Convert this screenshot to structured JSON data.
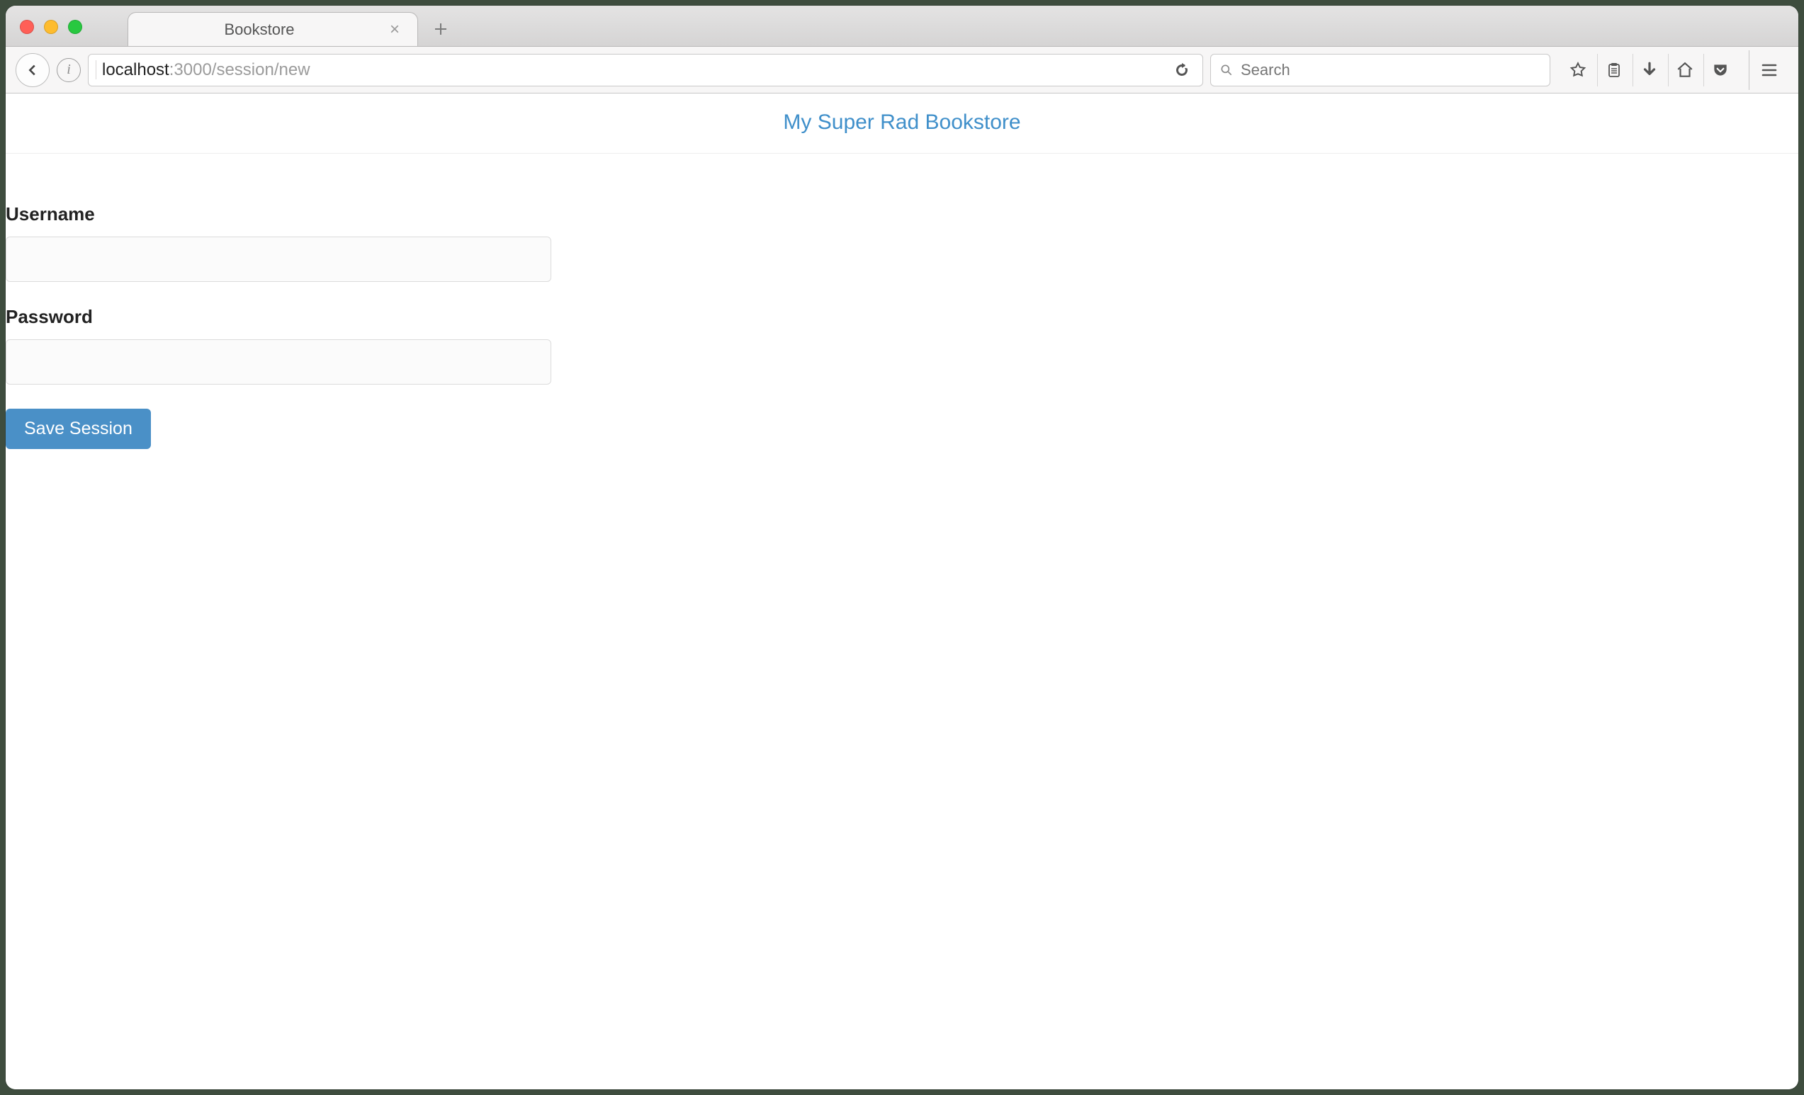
{
  "browser": {
    "tab_title": "Bookstore",
    "url_host": "localhost",
    "url_rest": ":3000/session/new",
    "search_placeholder": "Search"
  },
  "page": {
    "brand": "My Super Rad Bookstore",
    "username_label": "Username",
    "password_label": "Password",
    "username_value": "",
    "password_value": "",
    "submit_label": "Save Session"
  },
  "colors": {
    "link": "#3f8fca",
    "button_bg": "#4a90c7"
  }
}
